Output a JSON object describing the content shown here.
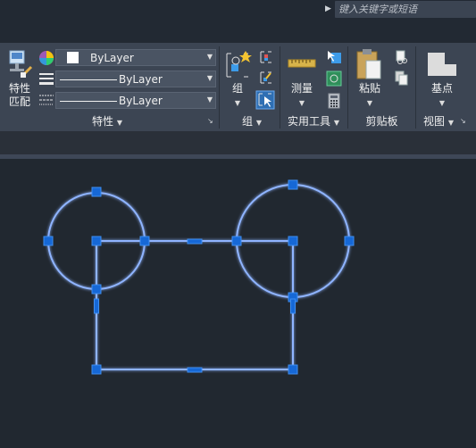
{
  "search": {
    "placeholder": "键入关键字或短语"
  },
  "properties_panel": {
    "match_button_line1": "特性",
    "match_button_line2": "匹配",
    "color_value": "ByLayer",
    "linetype_value": "ByLayer",
    "lineweight_value": "ByLayer",
    "title": "特性"
  },
  "group_panel": {
    "group_button": "组",
    "title": "组"
  },
  "utilities_panel": {
    "measure_button": "测量",
    "title": "实用工具"
  },
  "clipboard_panel": {
    "paste_button": "粘贴",
    "title": "剪贴板"
  },
  "view_panel": {
    "basepoint_button": "基点",
    "title": "视图"
  },
  "colors": {
    "geometry": "#8fb4ff",
    "grip": "#1668d6",
    "ribbon": "#3c4553",
    "canvas": "#212830"
  }
}
